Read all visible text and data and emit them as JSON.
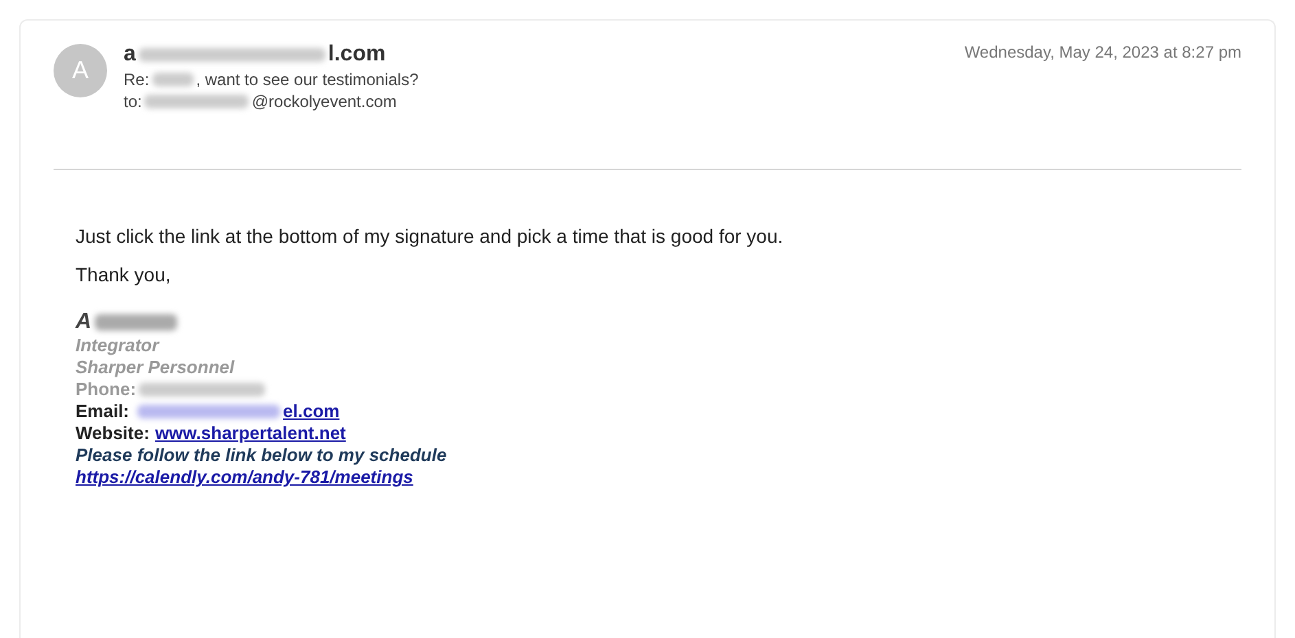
{
  "email": {
    "avatar": "A",
    "sender": {
      "before": "a",
      "after": "l.com"
    },
    "subject": {
      "before": "Re:",
      "after": ", want to see our testimonials?"
    },
    "to": {
      "label": "to:",
      "after": "@rockolyevent.com"
    },
    "date": "Wednesday, May 24, 2023 at 8:27 pm",
    "body": [
      "Just click the link at the bottom of my signature and pick a time that is good for you.",
      "Thank you,"
    ],
    "signature": {
      "name": "A",
      "title": "Integrator",
      "company": "Sharper Personnel",
      "phone_label": "Phone:",
      "email_label": "Email:",
      "email_after": "el.com",
      "website_label": "Website:",
      "website": "www.sharpertalent.net",
      "note": "Please follow the link below to my schedule",
      "link": "https://calendly.com/andy-781/meetings"
    }
  }
}
